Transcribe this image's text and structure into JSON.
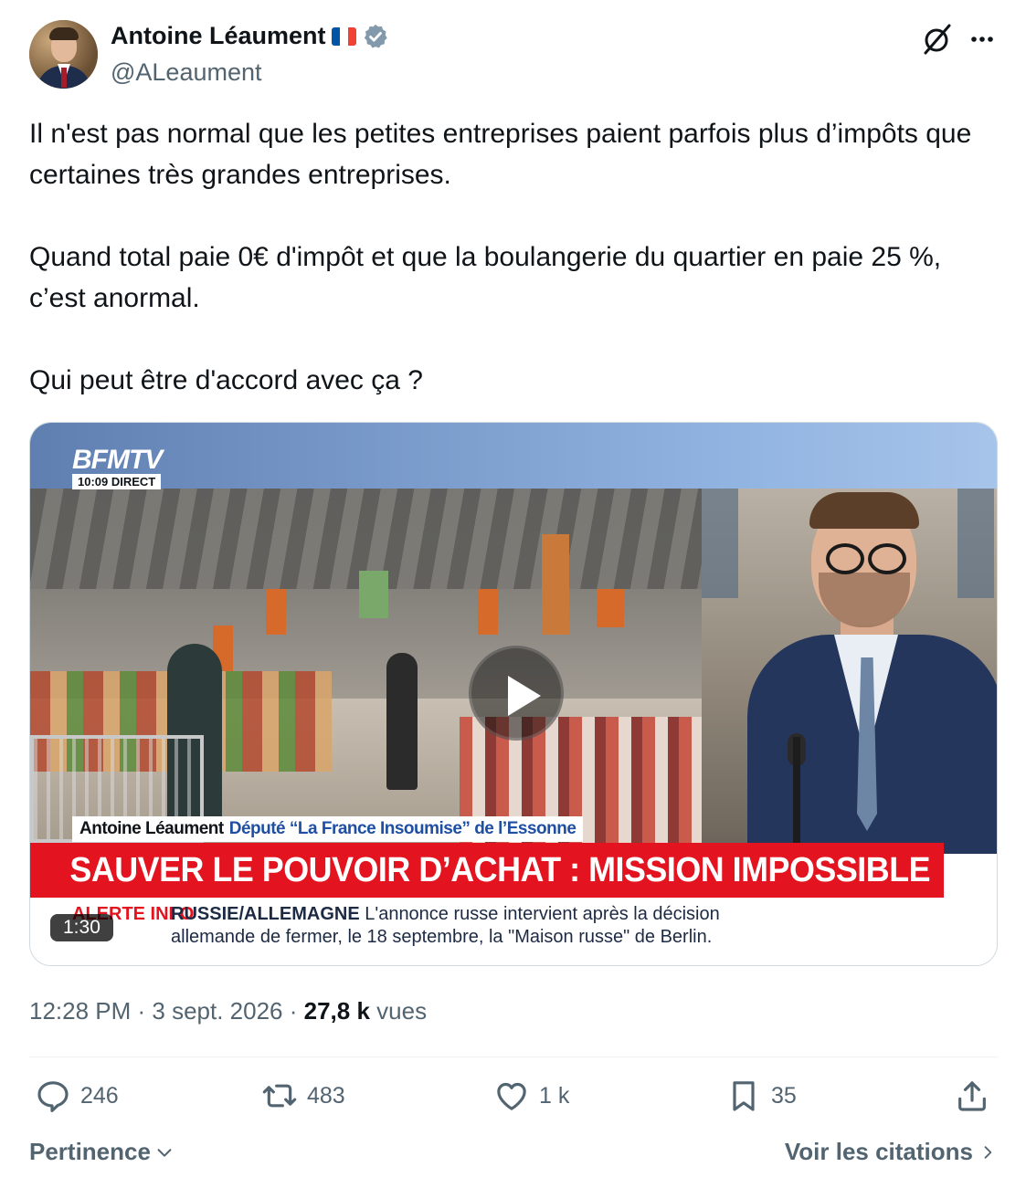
{
  "author": {
    "name": "Antoine Léaument",
    "handle": "@ALeaument",
    "flag_colors": [
      "#0055a4",
      "#ffffff",
      "#ef4135"
    ],
    "verified_color": "#829aab"
  },
  "tweet": {
    "paragraphs": [
      "Il n'est pas normal que les petites entreprises paient parfois plus d’impôts que certaines très grandes entreprises.",
      "Quand total paie 0€ d'impôt et que la boulangerie du quartier en paie 25 %, c’est anormal.",
      "Qui peut être d'accord avec ça ?"
    ]
  },
  "video": {
    "channel": "BFMTV",
    "live_badge": "10:09  DIRECT",
    "lower_third_name": "Antoine Léaument",
    "lower_third_role": "Député “La France Insoumise” de l’Essonne",
    "headline": "SAUVER LE POUVOIR D’ACHAT : MISSION IMPOSSIBLE ?",
    "ticker_label": "ALERTE INFO",
    "ticker_title": "RUSSIE/ALLEMAGNE",
    "ticker_line1": "L'annonce russe intervient après la décision",
    "ticker_line2": "allemande de fermer, le 18 septembre, la \"Maison russe\" de Berlin.",
    "duration": "1:30",
    "headline_color": "#e3141f"
  },
  "meta": {
    "time": "12:28 PM",
    "sep1": " · ",
    "date": "3 sept. 2026",
    "sep2": " · ",
    "views_count": "27,8 k",
    "views_label": "vues"
  },
  "actions": {
    "replies": "246",
    "reposts": "483",
    "likes": "1 k",
    "bookmarks": "35"
  },
  "footer": {
    "sort_label": "Pertinence",
    "quotes_label": "Voir les citations"
  },
  "colors": {
    "text_primary": "#0f1419",
    "text_secondary": "#536471"
  }
}
